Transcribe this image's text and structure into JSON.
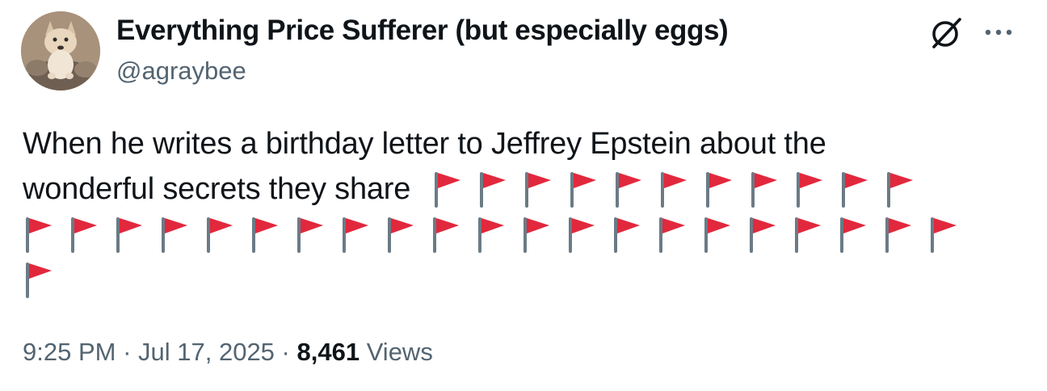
{
  "author": {
    "display_name": "Everything Price Sufferer (but especially eggs)",
    "handle": "@agraybee"
  },
  "icons": {
    "grok": "grok-icon",
    "more": "more-icon",
    "avatar": "avatar-dog"
  },
  "tweet": {
    "line1": "When he writes a birthday letter to Jeffrey Epstein about the",
    "line2": "wonderful secrets they share",
    "flag_emoji": "🚩",
    "flags_line2": 11,
    "flags_line3": 21,
    "flags_line4": 1
  },
  "meta": {
    "time": "9:25 PM",
    "sep1": " · ",
    "date": "Jul 17, 2025",
    "sep2": " · ",
    "views_count": "8,461",
    "views_label": " Views"
  },
  "colors": {
    "text": "#0f1419",
    "secondary": "#536471",
    "flag_red": "#e2283d",
    "flag_pole": "#6b7b86"
  }
}
